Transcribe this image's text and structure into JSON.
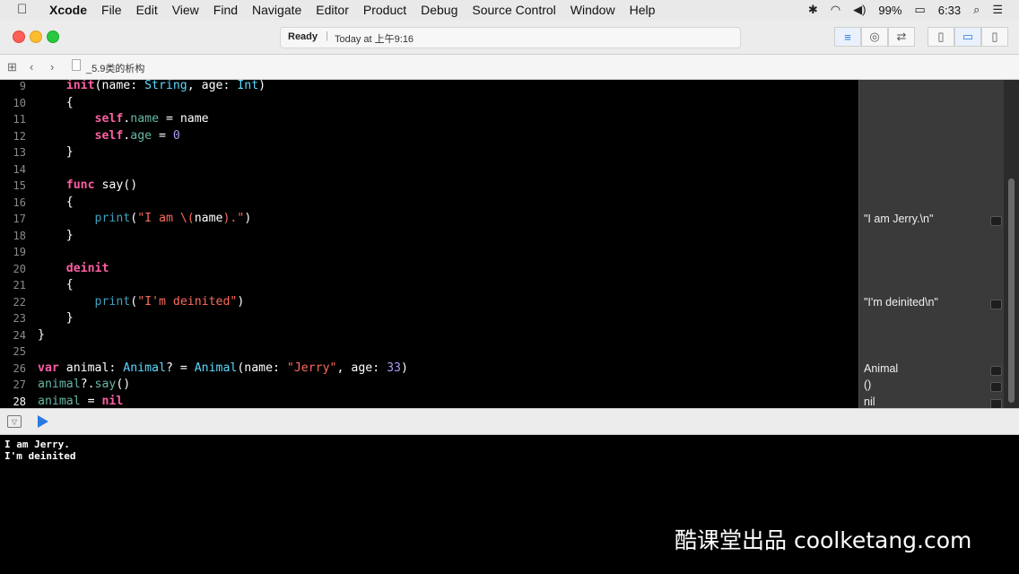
{
  "menubar": {
    "apple_icon": "apple-icon",
    "items": [
      "Xcode",
      "File",
      "Edit",
      "View",
      "Find",
      "Navigate",
      "Editor",
      "Product",
      "Debug",
      "Source Control",
      "Window",
      "Help"
    ],
    "battery": "99%",
    "clock": "6:33"
  },
  "toolbar": {
    "status": "Ready",
    "separator": "|",
    "time": "Today at 上午9:16"
  },
  "jumpbar": {
    "filename": "_5.9类的析构"
  },
  "editor": {
    "lines": [
      {
        "n": "9",
        "indent": "    ",
        "tokens": [
          [
            "kw",
            "init"
          ],
          [
            "pl",
            "(name: "
          ],
          [
            "ty",
            "String"
          ],
          [
            "pl",
            ", age: "
          ],
          [
            "ty",
            "Int"
          ],
          [
            "pl",
            ")"
          ]
        ]
      },
      {
        "n": "10",
        "indent": "    ",
        "tokens": [
          [
            "pl",
            "{"
          ]
        ]
      },
      {
        "n": "11",
        "indent": "        ",
        "tokens": [
          [
            "kw",
            "self"
          ],
          [
            "pl",
            "."
          ],
          [
            "pr",
            "name"
          ],
          [
            "pl",
            " = name"
          ]
        ]
      },
      {
        "n": "12",
        "indent": "        ",
        "tokens": [
          [
            "kw",
            "self"
          ],
          [
            "pl",
            "."
          ],
          [
            "pr",
            "age"
          ],
          [
            "pl",
            " = "
          ],
          [
            "num",
            "0"
          ]
        ]
      },
      {
        "n": "13",
        "indent": "    ",
        "tokens": [
          [
            "pl",
            "}"
          ]
        ]
      },
      {
        "n": "14",
        "indent": "",
        "tokens": []
      },
      {
        "n": "15",
        "indent": "    ",
        "tokens": [
          [
            "kw",
            "func"
          ],
          [
            "pl",
            " say()"
          ]
        ]
      },
      {
        "n": "16",
        "indent": "    ",
        "tokens": [
          [
            "pl",
            "{"
          ]
        ]
      },
      {
        "n": "17",
        "indent": "        ",
        "tokens": [
          [
            "fn",
            "print"
          ],
          [
            "pl",
            "("
          ],
          [
            "str",
            "\"I am \\("
          ],
          [
            "pl",
            "name"
          ],
          [
            "str",
            ").\""
          ],
          [
            "pl",
            ")"
          ]
        ]
      },
      {
        "n": "18",
        "indent": "    ",
        "tokens": [
          [
            "pl",
            "}"
          ]
        ]
      },
      {
        "n": "19",
        "indent": "",
        "tokens": []
      },
      {
        "n": "20",
        "indent": "    ",
        "tokens": [
          [
            "kw",
            "deinit"
          ]
        ]
      },
      {
        "n": "21",
        "indent": "    ",
        "tokens": [
          [
            "pl",
            "{"
          ]
        ]
      },
      {
        "n": "22",
        "indent": "        ",
        "tokens": [
          [
            "fn",
            "print"
          ],
          [
            "pl",
            "("
          ],
          [
            "str",
            "\"I'm deinited\""
          ],
          [
            "pl",
            ")"
          ]
        ]
      },
      {
        "n": "23",
        "indent": "    ",
        "tokens": [
          [
            "pl",
            "}"
          ]
        ]
      },
      {
        "n": "24",
        "indent": "",
        "tokens": [
          [
            "pl",
            "}"
          ]
        ]
      },
      {
        "n": "25",
        "indent": "",
        "tokens": []
      },
      {
        "n": "26",
        "indent": "",
        "tokens": [
          [
            "kw",
            "var"
          ],
          [
            "pl",
            " animal: "
          ],
          [
            "ty",
            "Animal"
          ],
          [
            "pl",
            "? = "
          ],
          [
            "ty",
            "Animal"
          ],
          [
            "pl",
            "(name: "
          ],
          [
            "str",
            "\"Jerry\""
          ],
          [
            "pl",
            ", age: "
          ],
          [
            "num",
            "33"
          ],
          [
            "pl",
            ")"
          ]
        ]
      },
      {
        "n": "27",
        "indent": "",
        "tokens": [
          [
            "pr",
            "animal"
          ],
          [
            "pl",
            "?."
          ],
          [
            "pr",
            "say"
          ],
          [
            "pl",
            "()"
          ]
        ]
      },
      {
        "n": "28",
        "indent": "",
        "tokens": [
          [
            "pr",
            "animal"
          ],
          [
            "pl",
            " = "
          ],
          [
            "kw",
            "nil"
          ]
        ]
      }
    ],
    "current_line": "28"
  },
  "results": [
    {
      "line": "17",
      "text": "\"I am Jerry.\\n\""
    },
    {
      "line": "22",
      "text": "\"I'm deinited\\n\""
    },
    {
      "line": "26",
      "text": "Animal"
    },
    {
      "line": "27",
      "text": "()"
    },
    {
      "line": "28",
      "text": "nil"
    }
  ],
  "console": {
    "lines": [
      "I am Jerry.",
      "I'm deinited"
    ]
  },
  "watermark": "酷课堂出品 coolketang.com"
}
